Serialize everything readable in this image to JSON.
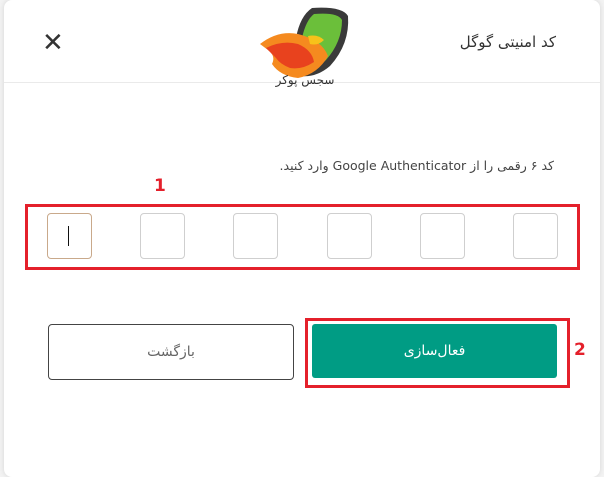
{
  "dialog": {
    "title": "کد امنیتی گوگل",
    "close_label": "✕"
  },
  "logo": {
    "text": "سجس پوکر"
  },
  "instruction": "کد ۶ رقمی را از Google Authenticator وارد کنید.",
  "otp": {
    "digits": [
      "",
      "",
      "",
      "",
      "",
      ""
    ]
  },
  "annotations": {
    "label_1": "1",
    "label_2": "2"
  },
  "buttons": {
    "back_label": "بازگشت",
    "activate_label": "فعال‌سازی"
  },
  "colors": {
    "primary": "#009c84",
    "annotation": "#e4202b"
  }
}
